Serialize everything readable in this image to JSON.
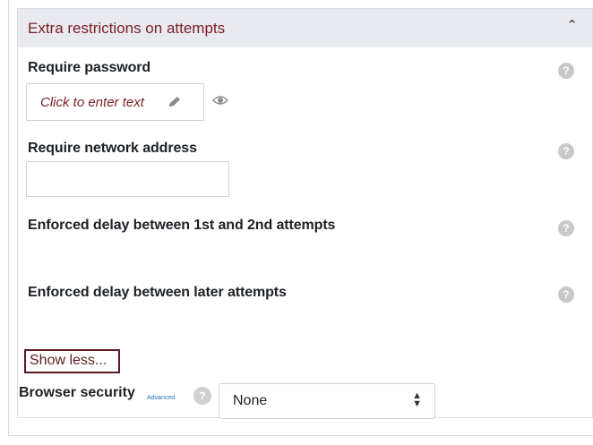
{
  "section": {
    "title": "Extra restrictions on attempts",
    "collapse_icon": "chevron-up-icon"
  },
  "password": {
    "label": "Require password",
    "placeholder_text": "Click to enter text",
    "edit_icon": "pencil-icon",
    "reveal_icon": "eye-icon"
  },
  "network": {
    "label": "Require network address",
    "value": ""
  },
  "delay1": {
    "label": "Enforced delay between 1st and 2nd attempts"
  },
  "delay2": {
    "label": "Enforced delay between later attempts"
  },
  "show_less": {
    "label": "Show less..."
  },
  "browser_security": {
    "label": "Browser security",
    "advanced_tag": "Advanced",
    "selected": "None"
  },
  "help_icon_glyph": "?",
  "colors": {
    "accent": "#7a1f24",
    "header_bg": "#e9eaf0",
    "help_icon": "#c8c8c8",
    "link": "#2a6fb5"
  }
}
